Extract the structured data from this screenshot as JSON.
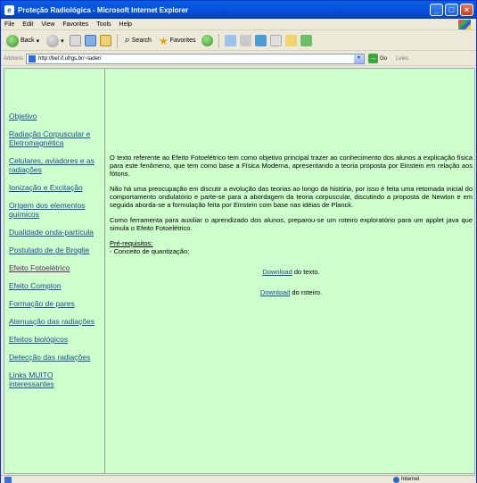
{
  "window": {
    "title": "Proteção Radiológica - Microsoft Internet Explorer"
  },
  "menu": [
    "File",
    "Edit",
    "View",
    "Favorites",
    "Tools",
    "Help"
  ],
  "toolbar": {
    "back": "Back",
    "search": "Search",
    "favorites": "Favorites"
  },
  "address": {
    "label": "Address",
    "url": "http://bef.if.ufrgs.br/~tader/",
    "go": "Go",
    "links": "Links"
  },
  "sidebar": {
    "items": [
      "Objetivo",
      "Radiação Corpuscular e Eletromagnética",
      "Celulares, aviadores e as radiações",
      "Ionização e Excitação",
      "Origem dos elementos químicos",
      "Dualidade onda-partícula",
      "Postulado de de Broglie",
      "Efeito Fotoelétrico",
      "Efeito Compton",
      "Formação de pares",
      "Atenuação das radiações",
      "Efeitos biológicos",
      "Detecção das radiações",
      "Links MUITO interessantes"
    ]
  },
  "main": {
    "p1": "O texto referente ao Efeito Fotoelétrico tem como objetivo principal trazer ao conhecimento dos alunos a explicação física para este fenômeno, que tem como base a Física Moderna, apresentando a teoria proposta por Einstein em relação aos fótons.",
    "p2": "Não há uma preocupação em discutir a evolução das teorias ao longo da história, por isso é feita uma retomada inicial do comportamento ondulatório e parte-se para a abordagem da teoria corpuscular, discutindo a proposta de Newton e em seguida aborda-se a formulação feita por Einstein com base nas idéias de Planck.",
    "p3": "Como ferramenta para auxiliar o aprendizado dos alunos, preparou-se um roteiro exploratório para um applet java que simula o Efeito Fotoelétrico.",
    "prereq_label": "Pré-requisitos:",
    "prereq_item": "- Conceito de quantização;",
    "dl_link": "Download",
    "dl1_rest": " do texto.",
    "dl2_rest": " do roteiro."
  },
  "status": {
    "zone": "Internet"
  }
}
